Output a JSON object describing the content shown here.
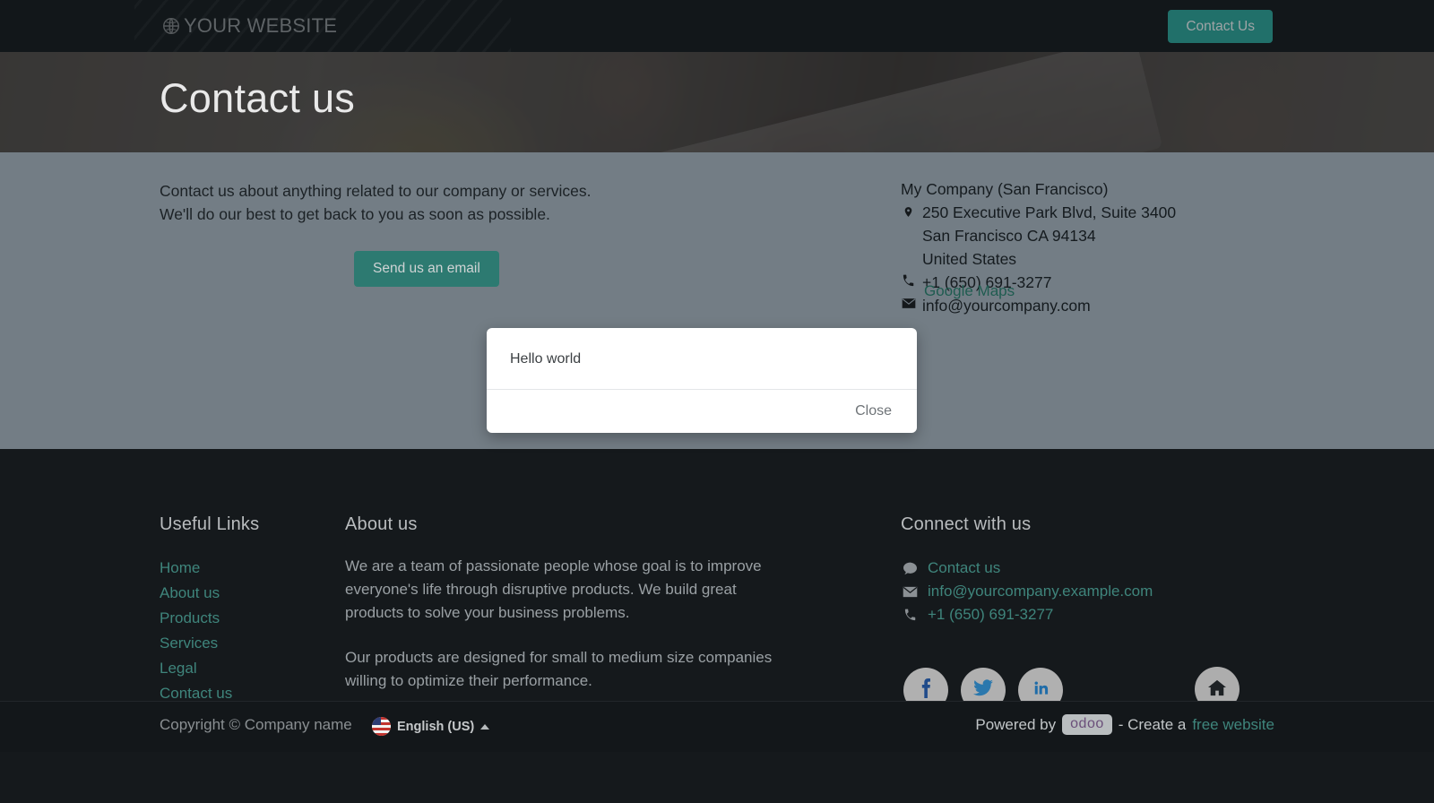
{
  "header": {
    "brand": "YOUR WEBSITE",
    "brand_icon": "globe-icon",
    "contact_button": "Contact Us"
  },
  "hero": {
    "title": "Contact us"
  },
  "main": {
    "intro_line1": "Contact us about anything related to our company or services.",
    "intro_line2": "We'll do our best to get back to you as soon as possible.",
    "send_email_button": "Send us an email",
    "company": {
      "name": "My Company (San Francisco)",
      "address_line1": "250 Executive Park Blvd, Suite 3400",
      "address_line2": "San Francisco CA 94134",
      "address_line3": "United States",
      "phone": "+1 (650) 691-3277",
      "email": "info@yourcompany.com",
      "maps_link": "Google Maps"
    }
  },
  "modal": {
    "body_text": "Hello world",
    "close_button": "Close"
  },
  "footer": {
    "useful_links_title": "Useful Links",
    "useful_links": [
      {
        "label": "Home"
      },
      {
        "label": "About us"
      },
      {
        "label": "Products"
      },
      {
        "label": "Services"
      },
      {
        "label": "Legal"
      },
      {
        "label": "Contact us"
      }
    ],
    "about_title": "About us",
    "about_paragraph1": "We are a team of passionate people whose goal is to improve everyone's life through disruptive products. We build great products to solve your business problems.",
    "about_paragraph2": "Our products are designed for small to medium size companies willing to optimize their performance.",
    "connect_title": "Connect with us",
    "connect_links": [
      {
        "icon": "comment-icon",
        "label": "Contact us"
      },
      {
        "icon": "envelope-icon",
        "label": "info@yourcompany.example.com"
      },
      {
        "icon": "phone-icon",
        "label": "+1 (650) 691-3277"
      }
    ],
    "socials": [
      {
        "icon": "facebook-icon"
      },
      {
        "icon": "twitter-icon"
      },
      {
        "icon": "linkedin-icon"
      }
    ],
    "home_icon": "home-icon"
  },
  "copyright": {
    "text": "Copyright © Company name",
    "language": "English (US)",
    "powered_by": "Powered by",
    "odoo_label": "odoo",
    "separator": "- Create a",
    "free_website": "free website"
  },
  "colors": {
    "accent_teal": "#21706a",
    "link_teal": "#3f857c",
    "dark_bg": "#15191c",
    "overlay_grey": "#737d85"
  }
}
